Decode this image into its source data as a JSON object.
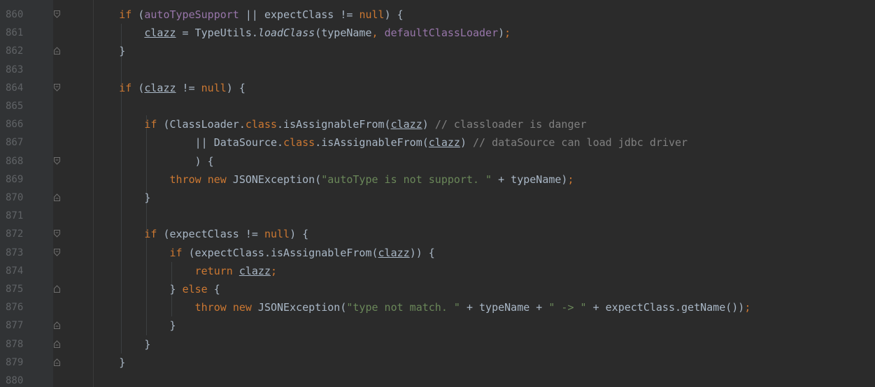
{
  "editor": {
    "lines": [
      {
        "n": "860",
        "indent": "        ",
        "tokens": [
          {
            "t": "if",
            "c": "kw"
          },
          {
            "t": " ("
          },
          {
            "t": "autoTypeSupport",
            "c": "fld"
          },
          {
            "t": " || expectClass != "
          },
          {
            "t": "null",
            "c": "kw"
          },
          {
            "t": ") {"
          }
        ],
        "fold": "start"
      },
      {
        "n": "861",
        "indent": "            ",
        "tokens": [
          {
            "t": "clazz",
            "c": "ul"
          },
          {
            "t": " = TypeUtils."
          },
          {
            "t": "loadClass",
            "c": "it"
          },
          {
            "t": "(typeName"
          },
          {
            "t": ",",
            "c": "kw"
          },
          {
            "t": " "
          },
          {
            "t": "defaultClassLoader",
            "c": "fld"
          },
          {
            "t": ")"
          },
          {
            "t": ";",
            "c": "kw"
          }
        ]
      },
      {
        "n": "862",
        "indent": "        ",
        "tokens": [
          {
            "t": "}"
          }
        ],
        "fold": "end"
      },
      {
        "n": "863",
        "indent": "",
        "tokens": []
      },
      {
        "n": "864",
        "indent": "        ",
        "tokens": [
          {
            "t": "if",
            "c": "kw"
          },
          {
            "t": " ("
          },
          {
            "t": "clazz",
            "c": "ul"
          },
          {
            "t": " != "
          },
          {
            "t": "null",
            "c": "kw"
          },
          {
            "t": ") {"
          }
        ],
        "fold": "start"
      },
      {
        "n": "865",
        "indent": "",
        "tokens": []
      },
      {
        "n": "866",
        "indent": "            ",
        "tokens": [
          {
            "t": "if",
            "c": "kw"
          },
          {
            "t": " (ClassLoader."
          },
          {
            "t": "class",
            "c": "kw"
          },
          {
            "t": ".isAssignableFrom("
          },
          {
            "t": "clazz",
            "c": "ul"
          },
          {
            "t": ") "
          },
          {
            "t": "// classloader is danger",
            "c": "cmt"
          }
        ]
      },
      {
        "n": "867",
        "indent": "                    ",
        "tokens": [
          {
            "t": "|| DataSource."
          },
          {
            "t": "class",
            "c": "kw"
          },
          {
            "t": ".isAssignableFrom("
          },
          {
            "t": "clazz",
            "c": "ul"
          },
          {
            "t": ") "
          },
          {
            "t": "// dataSource can load jdbc driver",
            "c": "cmt"
          }
        ]
      },
      {
        "n": "868",
        "indent": "                    ",
        "tokens": [
          {
            "t": ") {"
          }
        ],
        "fold": "start"
      },
      {
        "n": "869",
        "indent": "                ",
        "tokens": [
          {
            "t": "throw",
            "c": "kw"
          },
          {
            "t": " "
          },
          {
            "t": "new",
            "c": "kw"
          },
          {
            "t": " JSONException("
          },
          {
            "t": "\"autoType is not support. \"",
            "c": "str"
          },
          {
            "t": " + typeName)"
          },
          {
            "t": ";",
            "c": "kw"
          }
        ]
      },
      {
        "n": "870",
        "indent": "            ",
        "tokens": [
          {
            "t": "}"
          }
        ],
        "fold": "end"
      },
      {
        "n": "871",
        "indent": "",
        "tokens": []
      },
      {
        "n": "872",
        "indent": "            ",
        "tokens": [
          {
            "t": "if",
            "c": "kw"
          },
          {
            "t": " (expectClass != "
          },
          {
            "t": "null",
            "c": "kw"
          },
          {
            "t": ") {"
          }
        ],
        "fold": "start"
      },
      {
        "n": "873",
        "indent": "                ",
        "tokens": [
          {
            "t": "if",
            "c": "kw"
          },
          {
            "t": " (expectClass.isAssignableFrom("
          },
          {
            "t": "clazz",
            "c": "ul"
          },
          {
            "t": ")) {"
          }
        ],
        "fold": "start"
      },
      {
        "n": "874",
        "indent": "                    ",
        "tokens": [
          {
            "t": "return",
            "c": "kw"
          },
          {
            "t": " "
          },
          {
            "t": "clazz",
            "c": "ul"
          },
          {
            "t": ";",
            "c": "kw"
          }
        ]
      },
      {
        "n": "875",
        "indent": "                ",
        "tokens": [
          {
            "t": "} "
          },
          {
            "t": "else",
            "c": "kw"
          },
          {
            "t": " {"
          }
        ],
        "fold": "mid"
      },
      {
        "n": "876",
        "indent": "                    ",
        "tokens": [
          {
            "t": "throw",
            "c": "kw"
          },
          {
            "t": " "
          },
          {
            "t": "new",
            "c": "kw"
          },
          {
            "t": " JSONException("
          },
          {
            "t": "\"type not match. \"",
            "c": "str"
          },
          {
            "t": " + typeName + "
          },
          {
            "t": "\" -> \"",
            "c": "str"
          },
          {
            "t": " + expectClass.getName())"
          },
          {
            "t": ";",
            "c": "kw"
          }
        ]
      },
      {
        "n": "877",
        "indent": "                ",
        "tokens": [
          {
            "t": "}"
          }
        ],
        "fold": "end"
      },
      {
        "n": "878",
        "indent": "            ",
        "tokens": [
          {
            "t": "}"
          }
        ],
        "fold": "end"
      },
      {
        "n": "879",
        "indent": "        ",
        "tokens": [
          {
            "t": "}"
          }
        ],
        "fold": "end"
      },
      {
        "n": "880",
        "indent": "",
        "tokens": []
      }
    ]
  },
  "colors": {
    "background": "#2b2b2b",
    "keyword": "#cc7832",
    "field": "#9876aa",
    "string": "#6a8759",
    "comment": "#808080",
    "text": "#a9b7c6",
    "line_number": "#606366"
  }
}
